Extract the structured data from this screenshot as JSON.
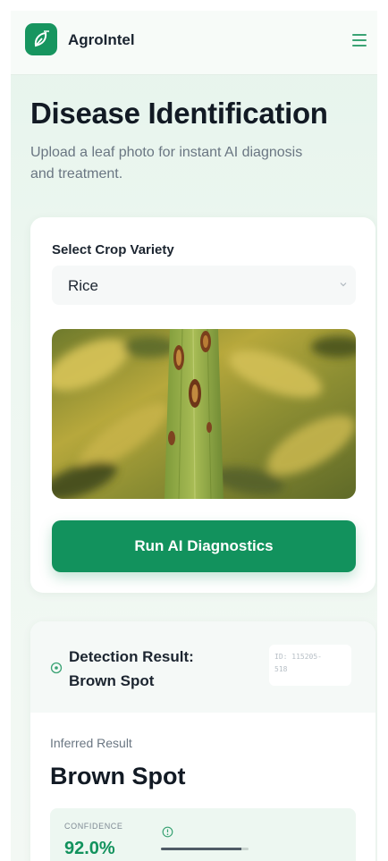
{
  "header": {
    "brand": "AgroIntel",
    "logo_icon": "leaf-logo-icon",
    "menu_icon": "hamburger-menu-icon"
  },
  "hero": {
    "title": "Disease Identification",
    "subtitle": "Upload a leaf photo for instant AI diagnosis and treatment."
  },
  "form": {
    "select_label": "Select Crop Variety",
    "selected_crop": "Rice",
    "select_icon": "chevron-down-icon",
    "photo_alt": "rice-leaf-photo",
    "run_button": "Run AI Diagnostics"
  },
  "result": {
    "heading_line1": "Detection Result:",
    "heading_line2": "Brown Spot",
    "scan_id_line1": "ID: 115205-",
    "scan_id_line2": "518",
    "inferred_label": "Inferred Result",
    "inferred_value": "Brown Spot",
    "confidence_label": "CONFIDENCE",
    "confidence_value": "92.0%",
    "confidence_fraction": 0.92
  },
  "colors": {
    "brand_green": "#12925d",
    "background": "#e6f4ec",
    "text_dark": "#121a24",
    "text_muted": "#6a7682"
  }
}
